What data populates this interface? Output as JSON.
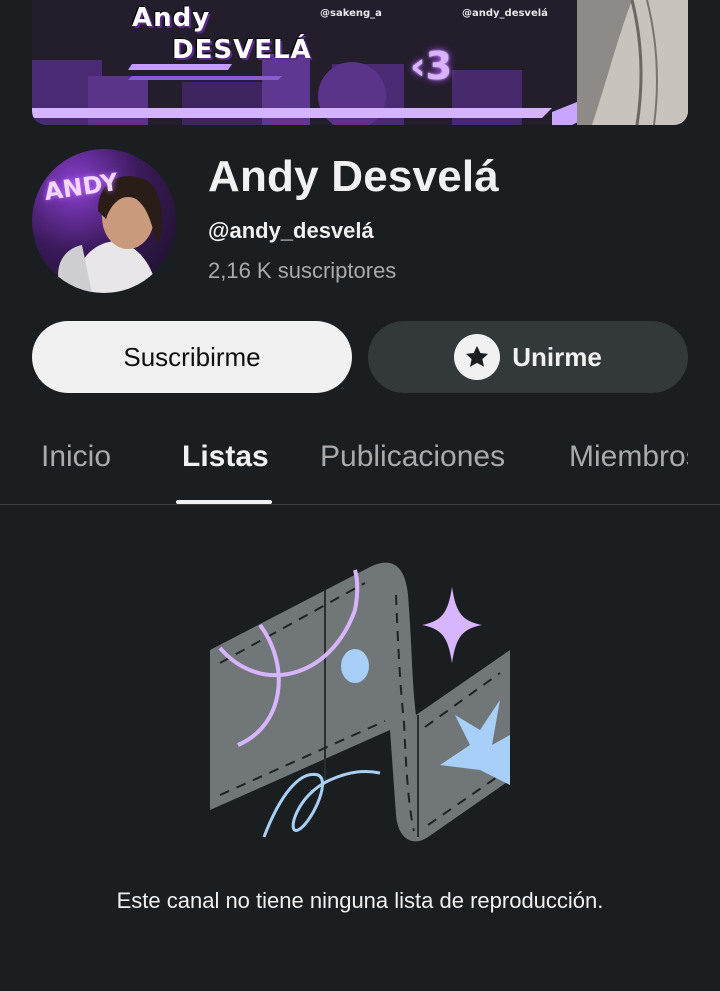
{
  "banner": {
    "title_line1": "Andy",
    "title_line2": "DESVELÁ",
    "handle_left": "@sakeng_a",
    "handle_right": "@andy_desvelá",
    "heart_text": "‹3"
  },
  "avatar": {
    "text": "ANDY"
  },
  "channel": {
    "name": "Andy Desvelá",
    "handle": "@andy_desvelá",
    "subscribers": "2,16 K suscriptores"
  },
  "actions": {
    "subscribe_label": "Suscribirme",
    "join_label": "Unirme",
    "join_icon": "star-icon"
  },
  "tabs": [
    {
      "label": "Inicio",
      "active": false
    },
    {
      "label": "Listas",
      "active": true
    },
    {
      "label": "Publicaciones",
      "active": false
    },
    {
      "label": "Miembros",
      "active": false
    }
  ],
  "empty_state": {
    "message": "Este canal no tiene ninguna lista de reproducción."
  },
  "colors": {
    "background": "#1b1e21",
    "subscribe_bg": "#f1f1f1",
    "join_bg": "#33393b",
    "accent_purple": "#d7b6ff",
    "accent_blue": "#a8cff7"
  }
}
